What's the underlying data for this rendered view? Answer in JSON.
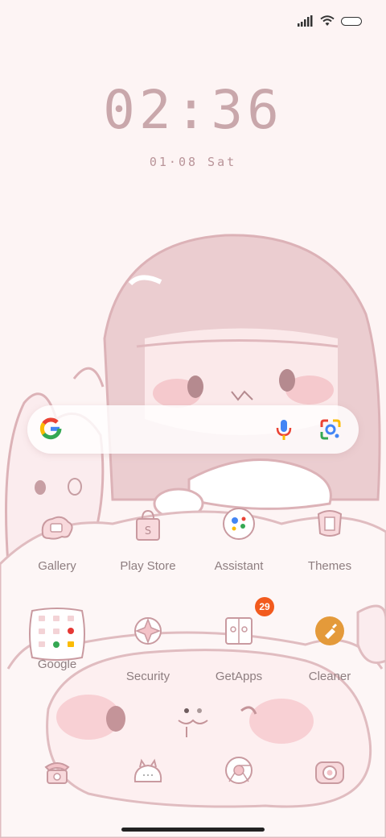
{
  "lockscreen": {
    "time": "02:36",
    "date": "01·08 Sat"
  },
  "status": {
    "signal_icon": "signal-icon",
    "wifi_icon": "wifi-icon",
    "battery_icon": "battery-icon"
  },
  "search": {
    "logo": "google-g-icon",
    "mic": "mic-icon",
    "lens": "lens-icon"
  },
  "apps": [
    {
      "label": "Gallery",
      "icon": "gallery-icon"
    },
    {
      "label": "Play Store",
      "icon": "play-store-icon"
    },
    {
      "label": "Assistant",
      "icon": "assistant-icon"
    },
    {
      "label": "Themes",
      "icon": "themes-icon"
    },
    {
      "label": "Google",
      "icon": "google-folder-icon"
    },
    {
      "label": "Security",
      "icon": "security-icon"
    },
    {
      "label": "GetApps",
      "icon": "getapps-icon",
      "badge": "29"
    },
    {
      "label": "Cleaner",
      "icon": "cleaner-icon"
    }
  ],
  "dock": [
    {
      "icon": "phone-icon"
    },
    {
      "icon": "messages-icon"
    },
    {
      "icon": "chrome-icon"
    },
    {
      "icon": "camera-icon"
    }
  ],
  "colors": {
    "accent": "#c9a7ab",
    "badge": "#f25a1d",
    "cleaner": "#e49a3a",
    "outline": "#d4a9ae"
  }
}
